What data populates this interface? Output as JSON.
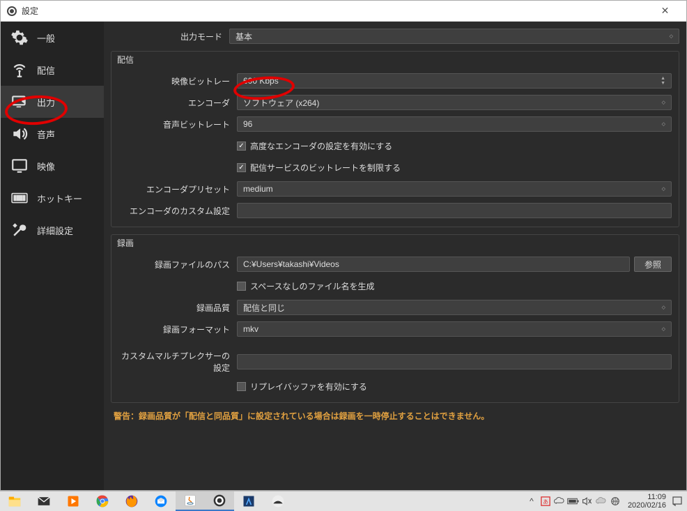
{
  "window": {
    "title": "設定"
  },
  "sidebar": {
    "items": [
      {
        "label": "一般"
      },
      {
        "label": "配信"
      },
      {
        "label": "出力"
      },
      {
        "label": "音声"
      },
      {
        "label": "映像"
      },
      {
        "label": "ホットキー"
      },
      {
        "label": "詳細設定"
      }
    ]
  },
  "top": {
    "output_mode_label": "出力モード",
    "output_mode_value": "基本"
  },
  "stream": {
    "title": "配信",
    "video_bitrate_label": "映像ビットレー",
    "video_bitrate_value": "600 Kbps",
    "encoder_label": "エンコーダ",
    "encoder_value": "ソフトウェア (x264)",
    "audio_bitrate_label": "音声ビットレート",
    "audio_bitrate_value": "96",
    "chk_advanced": "高度なエンコーダの設定を有効にする",
    "chk_limit": "配信サービスのビットレートを制限する",
    "preset_label": "エンコーダプリセット",
    "preset_value": "medium",
    "custom_enc_label": "エンコーダのカスタム設定",
    "custom_enc_value": ""
  },
  "record": {
    "title": "録画",
    "path_label": "録画ファイルのパス",
    "path_value": "C:¥Users¥takashi¥Videos",
    "browse": "参照",
    "chk_nospace": "スペースなしのファイル名を生成",
    "quality_label": "録画品質",
    "quality_value": "配信と同じ",
    "format_label": "録画フォーマット",
    "format_value": "mkv",
    "mux_label": "カスタムマルチプレクサーの設定",
    "mux_value": "",
    "chk_replay": "リプレイバッファを有効にする"
  },
  "warning": "警告：録画品質が「配信と同品質」に設定されている場合は録画を一時停止することはできません。",
  "taskbar": {
    "clock_time": "11:09",
    "clock_date": "2020/02/16"
  }
}
